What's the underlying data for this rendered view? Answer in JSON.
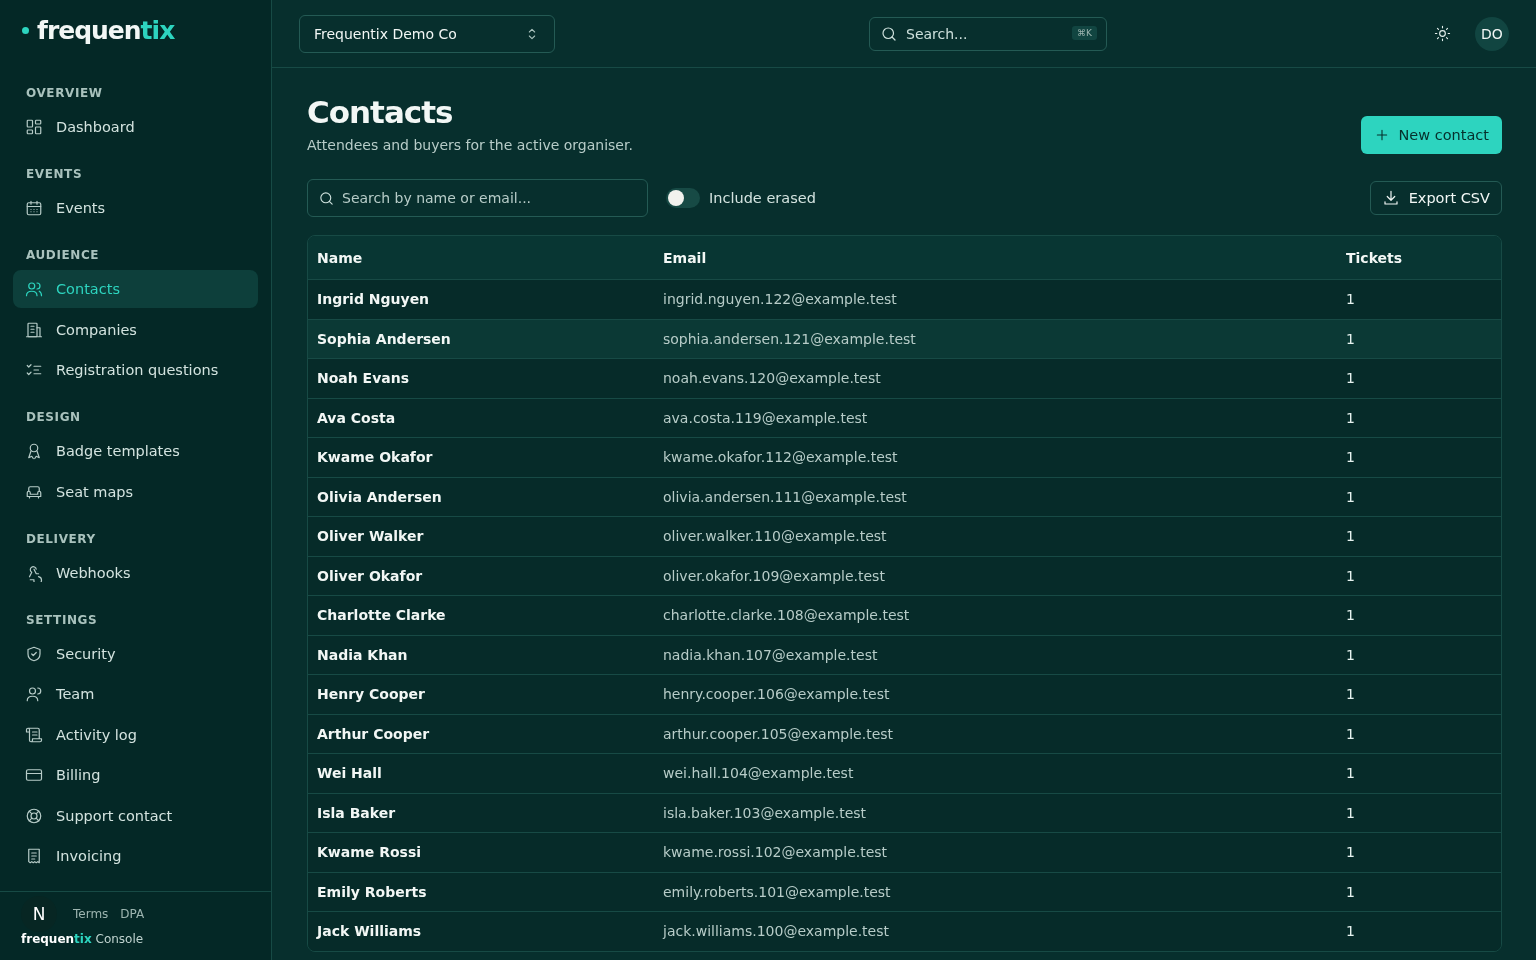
{
  "sidebar": {
    "logo": {
      "main": "frequen",
      "accent": "tix"
    },
    "sections": [
      {
        "title": "OVERVIEW",
        "items": [
          {
            "label": "Dashboard",
            "selected": false
          }
        ]
      },
      {
        "title": "EVENTS",
        "items": [
          {
            "label": "Events",
            "selected": false
          }
        ]
      },
      {
        "title": "AUDIENCE",
        "items": [
          {
            "label": "Contacts",
            "selected": true
          },
          {
            "label": "Companies",
            "selected": false
          },
          {
            "label": "Registration questions",
            "selected": false
          }
        ]
      },
      {
        "title": "DESIGN",
        "items": [
          {
            "label": "Badge templates",
            "selected": false
          },
          {
            "label": "Seat maps",
            "selected": false
          }
        ]
      },
      {
        "title": "DELIVERY",
        "items": [
          {
            "label": "Webhooks",
            "selected": false
          }
        ]
      },
      {
        "title": "SETTINGS",
        "items": [
          {
            "label": "Security",
            "selected": false
          },
          {
            "label": "Team",
            "selected": false
          },
          {
            "label": "Activity log",
            "selected": false
          },
          {
            "label": "Billing",
            "selected": false
          },
          {
            "label": "Support contact",
            "selected": false
          },
          {
            "label": "Invoicing",
            "selected": false
          }
        ]
      }
    ],
    "footer": {
      "links": [
        "Terms",
        "DPA"
      ],
      "dev_badge": "N",
      "brand_main": "frequen",
      "brand_accent": "tix",
      "brand_suffix": "Console"
    }
  },
  "topbar": {
    "organisation": "Frequentix Demo Co",
    "search": {
      "placeholder": "Search...",
      "shortcut": "⌘K"
    },
    "avatar": "DO"
  },
  "page": {
    "title": "Contacts",
    "subtitle": "Attendees and buyers for the active organiser.",
    "new_button": "New contact",
    "filter": {
      "placeholder": "Search by name or email...",
      "toggle_label": "Include erased",
      "toggle_on": false
    },
    "export_button": "Export CSV"
  },
  "table": {
    "columns": [
      "Name",
      "Email",
      "Tickets"
    ],
    "rows": [
      {
        "name": "Ingrid Nguyen",
        "email": "ingrid.nguyen.122@example.test",
        "tickets": "1",
        "selected": false
      },
      {
        "name": "Sophia Andersen",
        "email": "sophia.andersen.121@example.test",
        "tickets": "1",
        "selected": true
      },
      {
        "name": "Noah Evans",
        "email": "noah.evans.120@example.test",
        "tickets": "1",
        "selected": false
      },
      {
        "name": "Ava Costa",
        "email": "ava.costa.119@example.test",
        "tickets": "1",
        "selected": false
      },
      {
        "name": "Kwame Okafor",
        "email": "kwame.okafor.112@example.test",
        "tickets": "1",
        "selected": false
      },
      {
        "name": "Olivia Andersen",
        "email": "olivia.andersen.111@example.test",
        "tickets": "1",
        "selected": false
      },
      {
        "name": "Oliver Walker",
        "email": "oliver.walker.110@example.test",
        "tickets": "1",
        "selected": false
      },
      {
        "name": "Oliver Okafor",
        "email": "oliver.okafor.109@example.test",
        "tickets": "1",
        "selected": false
      },
      {
        "name": "Charlotte Clarke",
        "email": "charlotte.clarke.108@example.test",
        "tickets": "1",
        "selected": false
      },
      {
        "name": "Nadia Khan",
        "email": "nadia.khan.107@example.test",
        "tickets": "1",
        "selected": false
      },
      {
        "name": "Henry Cooper",
        "email": "henry.cooper.106@example.test",
        "tickets": "1",
        "selected": false
      },
      {
        "name": "Arthur Cooper",
        "email": "arthur.cooper.105@example.test",
        "tickets": "1",
        "selected": false
      },
      {
        "name": "Wei Hall",
        "email": "wei.hall.104@example.test",
        "tickets": "1",
        "selected": false
      },
      {
        "name": "Isla Baker",
        "email": "isla.baker.103@example.test",
        "tickets": "1",
        "selected": false
      },
      {
        "name": "Kwame Rossi",
        "email": "kwame.rossi.102@example.test",
        "tickets": "1",
        "selected": false
      },
      {
        "name": "Emily Roberts",
        "email": "emily.roberts.101@example.test",
        "tickets": "1",
        "selected": false
      },
      {
        "name": "Jack Williams",
        "email": "jack.williams.100@example.test",
        "tickets": "1",
        "selected": false
      }
    ]
  }
}
